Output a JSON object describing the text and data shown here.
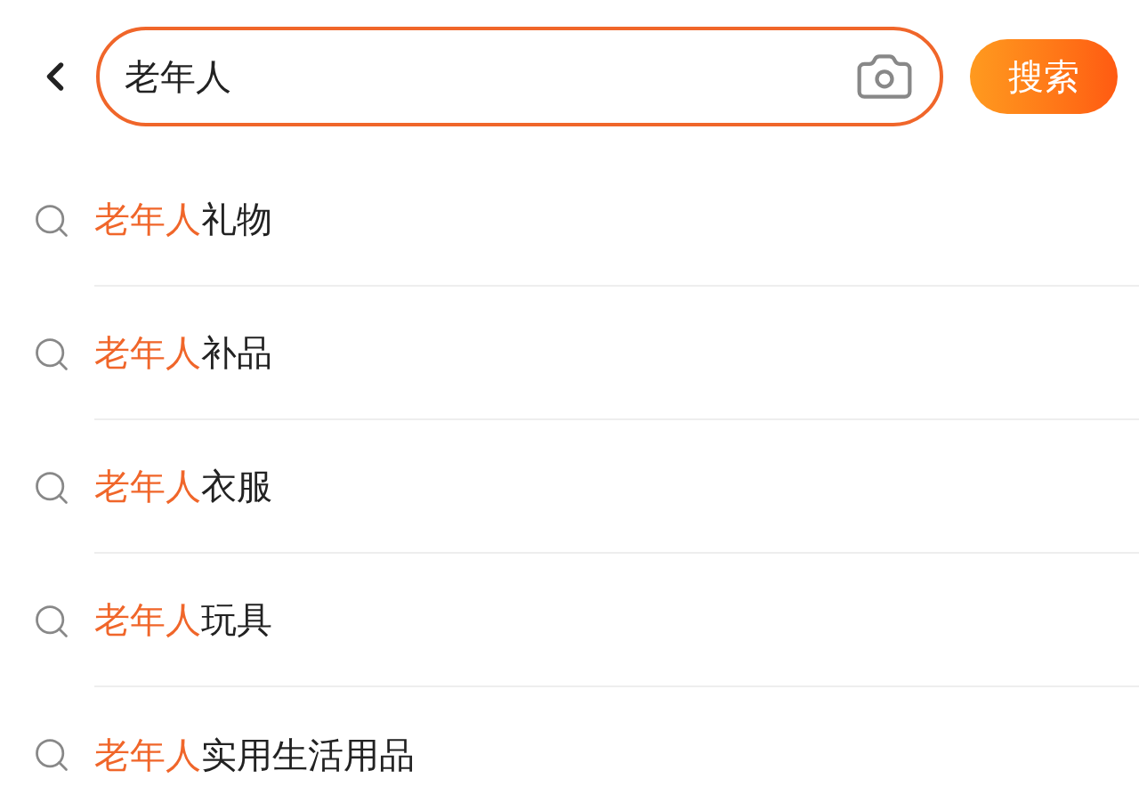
{
  "search": {
    "value": "老年人",
    "button": "搜索"
  },
  "suggestions": [
    {
      "highlight": "老年人",
      "rest": "礼物"
    },
    {
      "highlight": "老年人",
      "rest": "补品"
    },
    {
      "highlight": "老年人",
      "rest": "衣服"
    },
    {
      "highlight": "老年人",
      "rest": "玩具"
    },
    {
      "highlight": "老年人",
      "rest": "实用生活用品"
    }
  ]
}
